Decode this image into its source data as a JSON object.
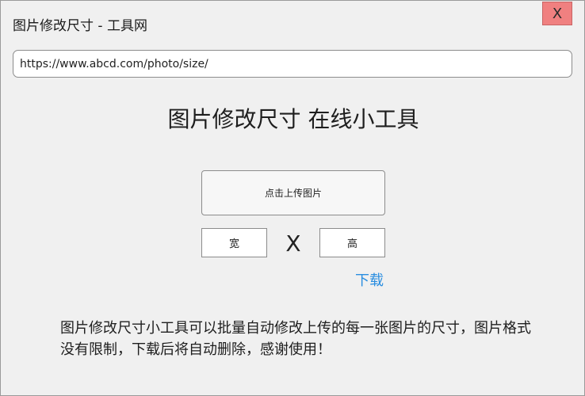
{
  "window": {
    "title": "图片修改尺寸 - 工具网",
    "close_label": "X"
  },
  "address_bar": {
    "url": "https://www.abcd.com/photo/size/"
  },
  "main": {
    "headline": "图片修改尺寸 在线小工具",
    "upload_label": "点击上传图片",
    "width_placeholder": "宽",
    "times_symbol": "X",
    "height_placeholder": "高",
    "download_label": "下载",
    "description": "图片修改尺寸小工具可以批量自动修改上传的每一张图片的尺寸，图片格式没有限制，下载后将自动删除，感谢使用！"
  },
  "colors": {
    "close_button_bg": "#f08080",
    "link": "#2a8ee0",
    "window_bg": "#f0f0f0"
  }
}
